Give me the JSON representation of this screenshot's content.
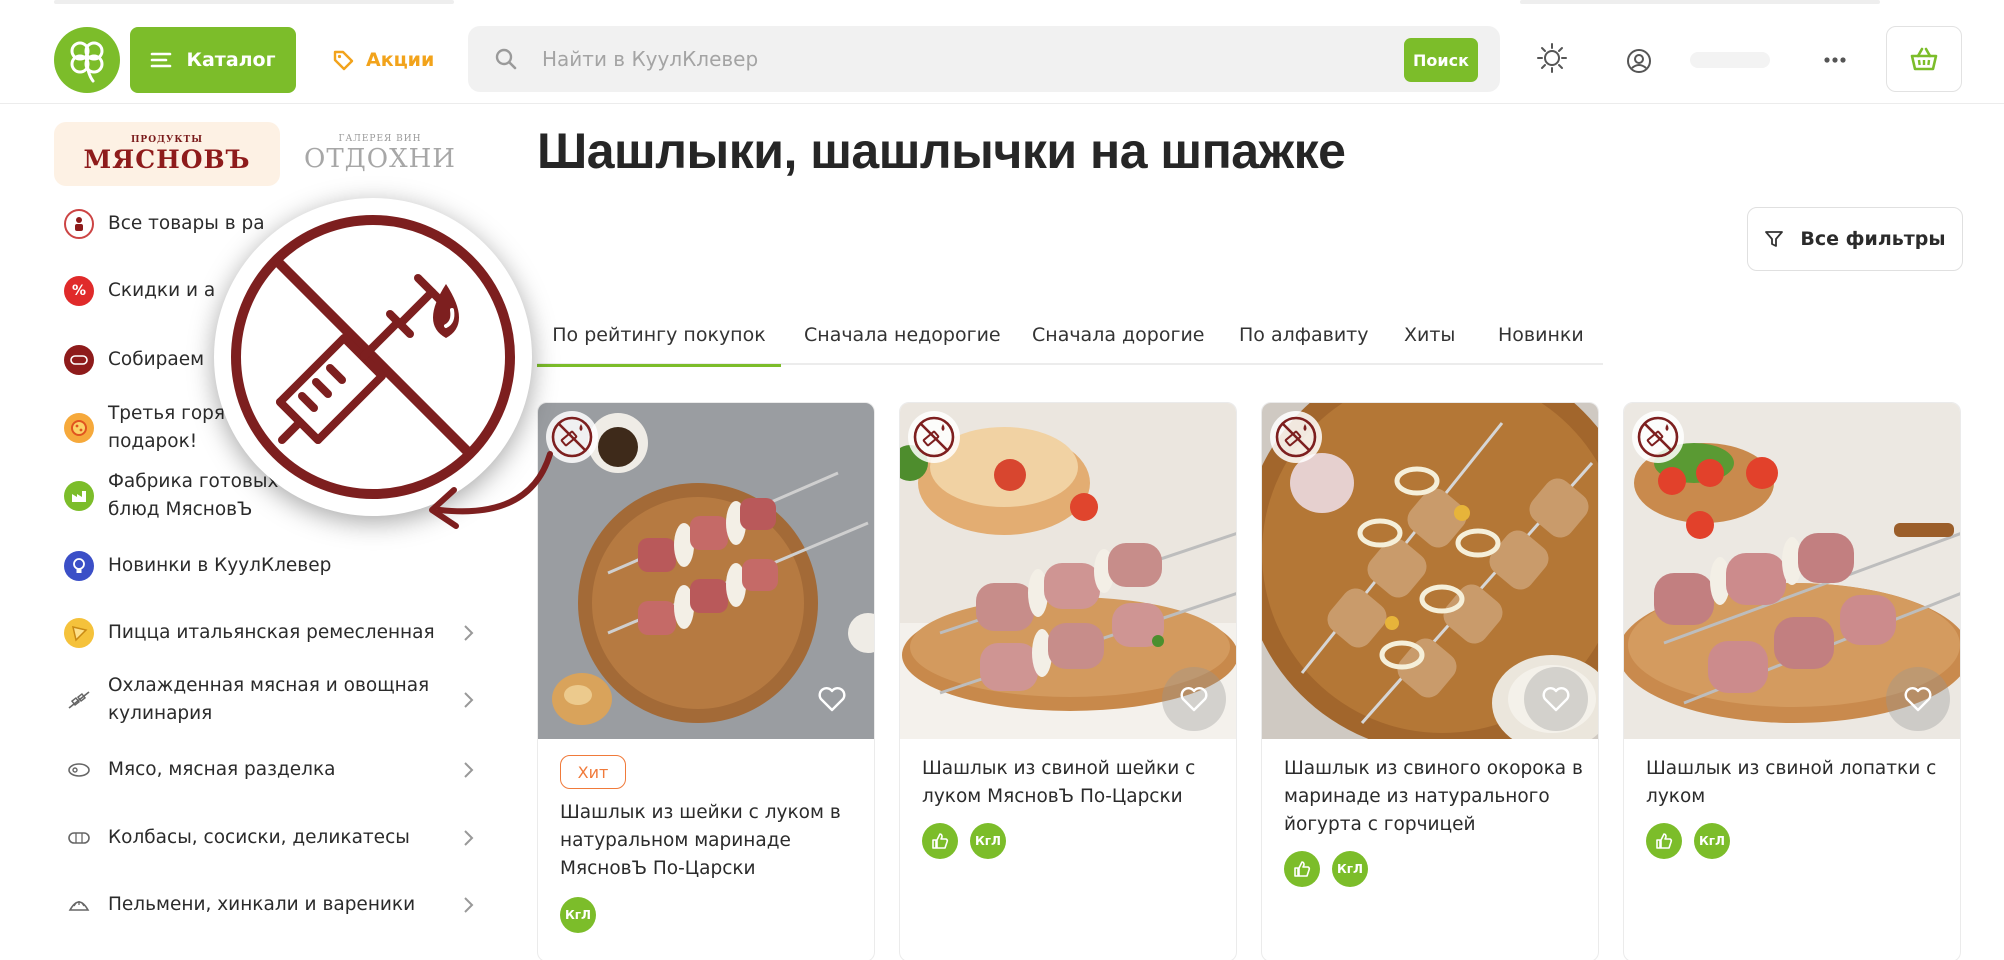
{
  "header": {
    "catalog_label": "Каталог",
    "promo_label": "Акции",
    "search_placeholder": "Найти в КуулКлевер",
    "search_button": "Поиск"
  },
  "sidebar": {
    "brands": [
      {
        "small": "ПРОДУКТЫ",
        "name": "МЯСНОВЪ"
      },
      {
        "small": "ГАЛЕРЕЯ ВИН",
        "name": "ОТДОХНИ"
      }
    ],
    "items": [
      {
        "label": "Все товары в ра",
        "icon": "miasnov-logo-icon",
        "has_arrow": false
      },
      {
        "label": "Скидки и а",
        "icon": "discount-icon",
        "has_arrow": false
      },
      {
        "label": "Собираем",
        "icon": "collect-icon",
        "has_arrow": false
      },
      {
        "label": "Третья горя\nподарок!",
        "icon": "pizza-gift-icon",
        "has_arrow": false
      },
      {
        "label": "Фабрика готовых\nблюд МясновЪ",
        "icon": "factory-icon",
        "has_arrow": false
      },
      {
        "label": "Новинки в КуулКлевер",
        "icon": "bulb-icon",
        "has_arrow": false
      },
      {
        "label": "Пицца итальянская ремесленная",
        "icon": "pizza-icon",
        "has_arrow": true
      },
      {
        "label": "Охлажденная мясная и овощная\nкулинария",
        "icon": "skewer-icon",
        "has_arrow": true
      },
      {
        "label": "Мясо, мясная разделка",
        "icon": "meat-icon",
        "has_arrow": true
      },
      {
        "label": "Колбасы, сосиски, деликатесы",
        "icon": "sausage-icon",
        "has_arrow": true
      },
      {
        "label": "Пельмени, хинкали и вареники",
        "icon": "dumpling-icon",
        "has_arrow": true
      }
    ]
  },
  "main": {
    "title": "Шашлыки, шашлычки на шпажке",
    "filters_label": "Все фильтры",
    "sort_tabs": [
      {
        "label": "По рейтингу покупок",
        "active": true
      },
      {
        "label": "Сначала недорогие",
        "active": false
      },
      {
        "label": "Сначала дорогие",
        "active": false
      },
      {
        "label": "По алфавиту",
        "active": false
      },
      {
        "label": "Хиты",
        "active": false
      },
      {
        "label": "Новинки",
        "active": false
      }
    ],
    "products": [
      {
        "name": "Шашлык из шейки с луком в натуральном маринаде МясновЪ По-Царски",
        "badge": "Хит",
        "tags": [
          "КгЛ"
        ]
      },
      {
        "name": "Шашлык из свиной шейки с луком МясновЪ По-Царски",
        "badge": "",
        "tags": [
          "like",
          "КгЛ"
        ]
      },
      {
        "name": "Шашлык из свиного окорока в маринаде из натурального йогурта с горчицей",
        "badge": "",
        "tags": [
          "like",
          "КгЛ"
        ]
      },
      {
        "name": "Шашлык из свиной лопатки с луком",
        "badge": "",
        "tags": [
          "like",
          "КгЛ"
        ]
      }
    ]
  },
  "colors": {
    "brand_green": "#7cbd2a",
    "promo_orange": "#f2a31b",
    "hit_orange": "#f07a3a",
    "badge_maroon": "#7d1f1f"
  }
}
